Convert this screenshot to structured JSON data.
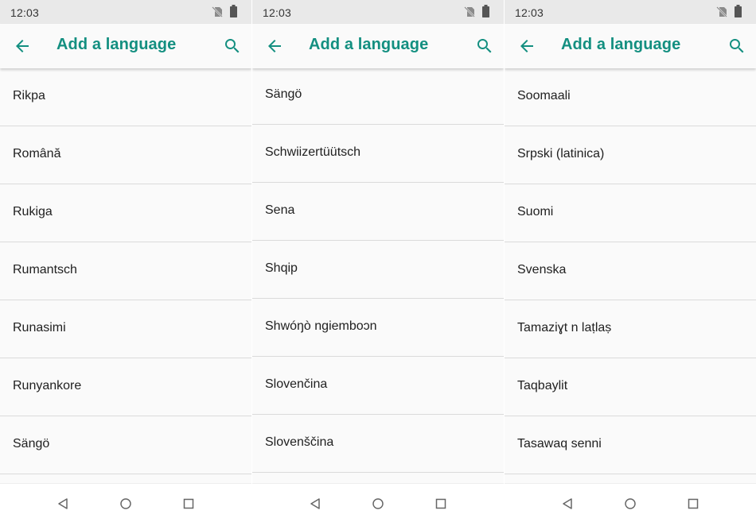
{
  "colors": {
    "accent": "#138f80",
    "status_bar": "#e9e9e9",
    "background": "#fafafa",
    "divider": "#dadada"
  },
  "icons": [
    "no-sim-icon",
    "battery-icon",
    "back-arrow-icon",
    "search-icon",
    "nav-back-icon",
    "nav-home-icon",
    "nav-recents-icon"
  ],
  "panels": [
    {
      "status": {
        "time": "12:03"
      },
      "header": {
        "title": "Add a language"
      },
      "languages": [
        "Rikpa",
        "Română",
        "Rukiga",
        "Rumantsch",
        "Runasimi",
        "Runyankore",
        "Sängö"
      ]
    },
    {
      "status": {
        "time": "12:03"
      },
      "header": {
        "title": "Add a language"
      },
      "languages": [
        "Sängö",
        "Schwiizertüütsch",
        "Sena",
        "Shqip",
        "Shwóŋò ngiemboɔn",
        "Slovenčina",
        "Slovenščina"
      ]
    },
    {
      "status": {
        "time": "12:03"
      },
      "header": {
        "title": "Add a language"
      },
      "languages": [
        "Soomaali",
        "Srpski (latinica)",
        "Suomi",
        "Svenska",
        "Tamaziɣt n laṭlaṣ",
        "Taqbaylit",
        "Tasawaq senni"
      ]
    }
  ]
}
